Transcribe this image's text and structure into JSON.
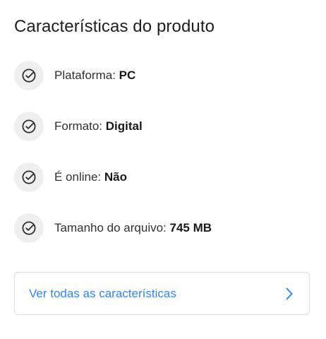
{
  "title": "Características do produto",
  "features": [
    {
      "label": "Plataforma:",
      "value": "PC",
      "icon": "check-circle-icon"
    },
    {
      "label": "Formato:",
      "value": "Digital",
      "icon": "check-circle-icon"
    },
    {
      "label": "É online:",
      "value": "Não",
      "icon": "check-circle-icon"
    },
    {
      "label": "Tamanho do arquivo:",
      "value": "745 MB",
      "icon": "check-circle-icon"
    }
  ],
  "see_all": {
    "label": "Ver todas as características",
    "icon": "chevron-right-icon"
  },
  "colors": {
    "accent": "#3483fa",
    "icon_bg": "#efefef",
    "border": "#dcdcdc"
  }
}
